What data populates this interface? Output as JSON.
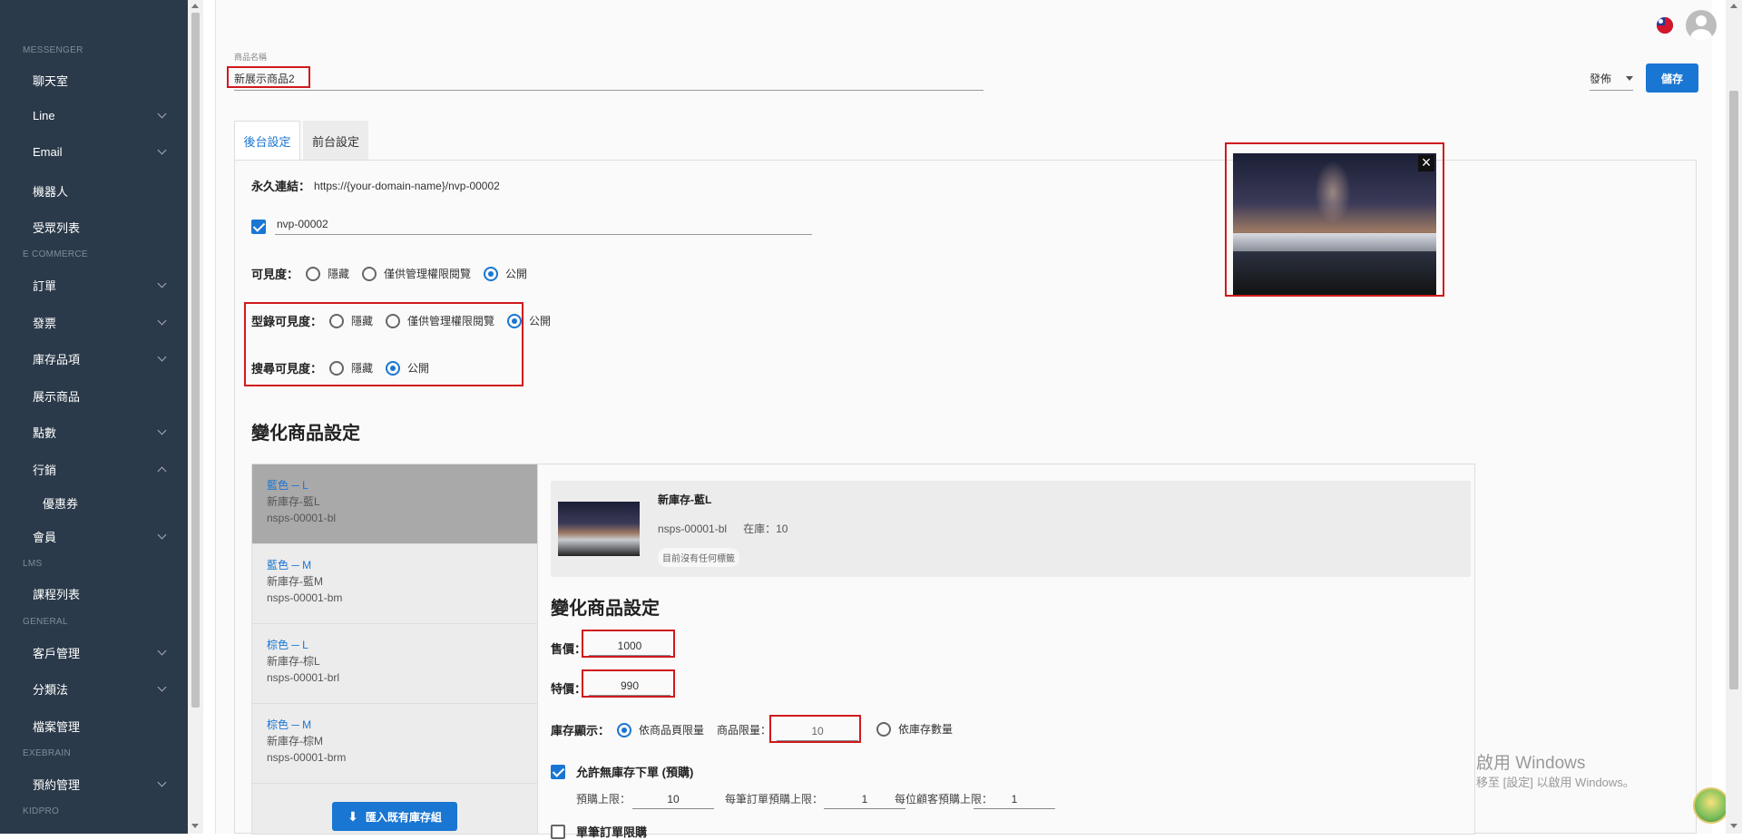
{
  "sidebar": {
    "sections": [
      "MESSENGER",
      "E COMMERCE",
      "LMS",
      "GENERAL",
      "EXEBRAIN",
      "KIDPRO"
    ],
    "items": [
      "聊天室",
      "Line",
      "Email",
      "機器人",
      "受眾列表",
      "訂單",
      "發票",
      "庫存品項",
      "展示商品",
      "點數",
      "行銷",
      "優惠券",
      "會員",
      "課程列表",
      "客戶管理",
      "分類法",
      "檔案管理",
      "預約管理"
    ]
  },
  "product": {
    "name_label": "商品名稱",
    "name_value": "新展示商品2",
    "publish": "發佈",
    "save": "儲存"
  },
  "tabs": [
    "後台設定",
    "前台設定"
  ],
  "settings": {
    "permalink_label": "永久連結：",
    "permalink_value": "https://{your-domain-name}/nvp-00002",
    "slug_value": "nvp-00002",
    "visibility_label": "可見度：",
    "catalog_visibility_label": "型錄可見度：",
    "search_visibility_label": "搜尋可見度：",
    "opt_hidden": "隱藏",
    "opt_admin": "僅供管理權限閱覽",
    "opt_public": "公開"
  },
  "variations": {
    "heading": "變化商品設定",
    "items": [
      {
        "title": "藍色 ─ L",
        "name": "新庫存-藍L",
        "sku": "nsps-00001-bl"
      },
      {
        "title": "藍色 ─ M",
        "name": "新庫存-藍M",
        "sku": "nsps-00001-bm"
      },
      {
        "title": "棕色 ─ L",
        "name": "新庫存-棕L",
        "sku": "nsps-00001-brl"
      },
      {
        "title": "棕色 ─ M",
        "name": "新庫存-棕M",
        "sku": "nsps-00001-brm"
      }
    ],
    "import_button": "匯入既有庫存組"
  },
  "detail": {
    "name": "新庫存-藍L",
    "sku": "nsps-00001-bl",
    "stock": "在庫：10",
    "tag": "目前沒有任何標籤",
    "heading": "變化商品設定",
    "price_label": "售價：",
    "price": "1000",
    "sale_label": "特價：",
    "sale": "990",
    "stock_display_label": "庫存顯示：",
    "by_limit": "依商品頁限量",
    "limit_label": "商品限量：",
    "limit": "10",
    "by_stock": "依庫存數量",
    "allow_preorder": "允許無庫存下單 (預購)",
    "preorder_max_label": "預購上限：",
    "preorder_max": "10",
    "per_order_label": "每筆訂單預購上限：",
    "per_order": "1",
    "per_customer_label": "每位顧客預購上限：",
    "per_customer": "1",
    "single_limit": "單筆訂單限購"
  },
  "watermark": {
    "line1": "啟用 Windows",
    "line2": "移至 [設定] 以啟用 Windows。"
  }
}
